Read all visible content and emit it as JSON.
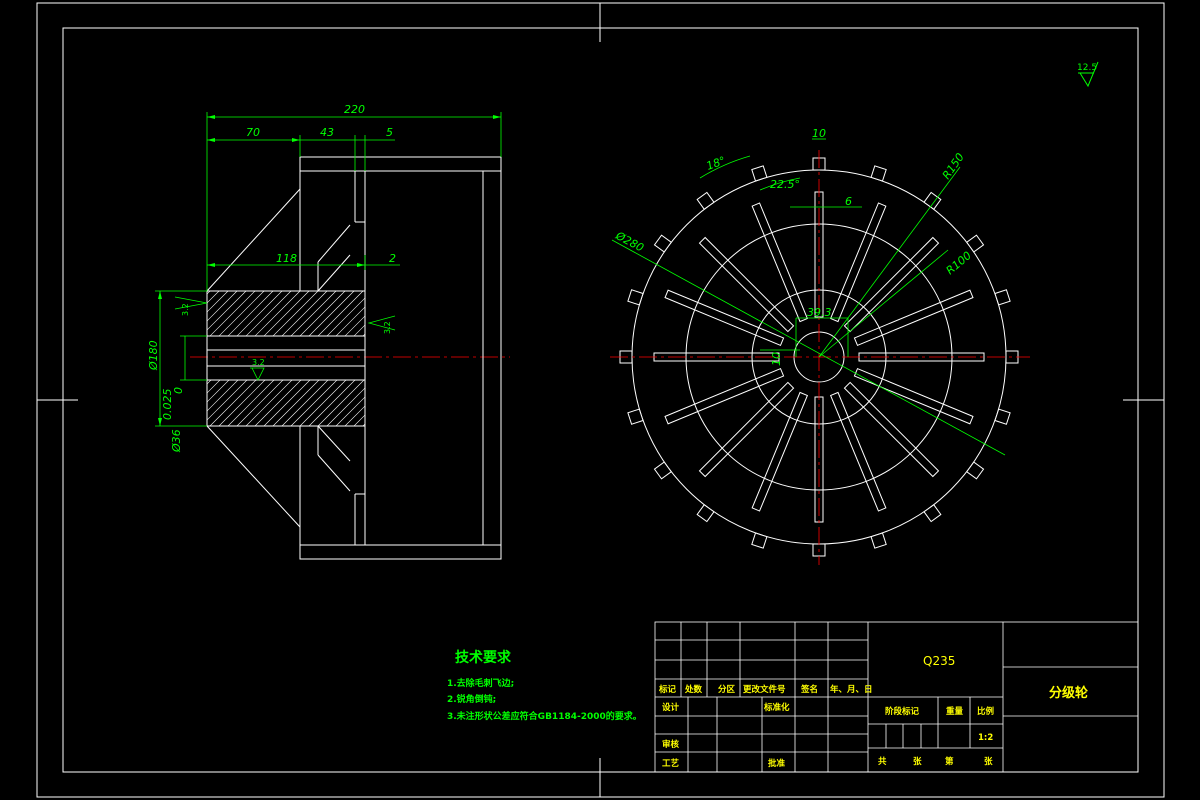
{
  "colors": {
    "background": "#000000",
    "outline": "#ffffff",
    "dimension": "#00ff00",
    "centerline": "#ff0000",
    "title_text": "#ffff00",
    "note_text": "#00ff00",
    "hatch": "#ffffff"
  },
  "side_view": {
    "dims": {
      "overall": "220",
      "seg1": "70",
      "seg2": "43",
      "seg3": "5",
      "inner": "118",
      "step": "2",
      "dia_outer": "Ø180",
      "dia_bore": "Ø36",
      "bore_tol": "0.025",
      "bore_tol_prefix": "0"
    },
    "roughness": [
      "3.2",
      "3.2",
      "3.2"
    ]
  },
  "front_view": {
    "dims": {
      "width": "10",
      "angle1": "18°",
      "angle2": "22.5°",
      "slot": "6",
      "r_outer": "R150",
      "r_inner": "R100",
      "dia": "Ø280",
      "hub": "39.3",
      "key": "10"
    }
  },
  "roughness_symbol": "12.5",
  "tech_requirements": {
    "title": "技术要求",
    "items": [
      "1.去除毛刺飞边;",
      "2.锐角倒钝;",
      "3.未注形状公差应符合GB1184-2000的要求。"
    ]
  },
  "title_block": {
    "material": "Q235",
    "part_name": "分级轮",
    "scale": "1:2",
    "labels": {
      "mark": "标记",
      "count": "处数",
      "zone": "分区",
      "doc_no": "更改文件号",
      "sign": "签名",
      "date": "年、月、日",
      "design": "设计",
      "standard": "标准化",
      "stage_mark": "阶段标记",
      "weight": "重量",
      "ratio": "比例",
      "review": "审核",
      "process": "工艺",
      "approve": "批准",
      "total": "共",
      "sheets": "张",
      "page": "第",
      "sheet_unit": "张"
    }
  }
}
